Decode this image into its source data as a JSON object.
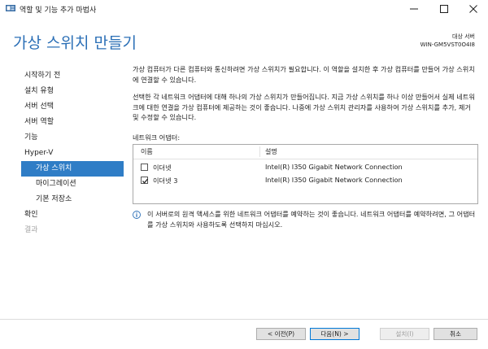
{
  "window": {
    "title": "역할 및 기능 추가 마법사"
  },
  "header": {
    "page_title": "가상 스위치 만들기",
    "target_label": "대상 서버",
    "target_value": "WIN-GM5VST0O4I8"
  },
  "nav": {
    "items": [
      {
        "label": "시작하기 전"
      },
      {
        "label": "설치 유형"
      },
      {
        "label": "서버 선택"
      },
      {
        "label": "서버 역할"
      },
      {
        "label": "기능"
      },
      {
        "label": "Hyper-V"
      },
      {
        "label": "가상 스위치"
      },
      {
        "label": "마이그레이션"
      },
      {
        "label": "기본 저장소"
      },
      {
        "label": "확인"
      },
      {
        "label": "결과"
      }
    ]
  },
  "content": {
    "paragraph1": "가상 컴퓨터가 다른 컴퓨터와 통신하려면 가상 스위치가 필요합니다. 이 역할을 설치한 후 가상 컴퓨터를 만들어 가상 스위치에 연결할 수 있습니다.",
    "paragraph2": "선택한 각 네트워크 어댑터에 대해 하나의 가상 스위치가 만들어집니다. 지금 가상 스위치를 하나 이상 만들어서 실제 네트워크에 대한 연결을 가상 컴퓨터에 제공하는 것이 좋습니다. 나중에 가상 스위치 관리자를 사용하여 가상 스위치를 추가, 제거 및 수정할 수 있습니다.",
    "adapter_label": "네트워크 어댑터:",
    "table": {
      "headers": {
        "name": "이름",
        "description": "설명"
      },
      "rows": [
        {
          "name": "이더넷",
          "description": "Intel(R) I350 Gigabit Network Connection",
          "checked": false
        },
        {
          "name": "이더넷 3",
          "description": "Intel(R) I350 Gigabit Network Connection",
          "checked": true
        }
      ]
    },
    "info_text": "이 서버로의 원격 액세스를 위한 네트워크 어댑터를 예약하는 것이 좋습니다. 네트워크 어댑터를 예약하려면, 그 어댑터를 가상 스위치와 사용하도록 선택하지 마십시오."
  },
  "footer": {
    "prev_label": "< 이전(P)",
    "next_label": "다음(N) >",
    "install_label": "설치(I)",
    "cancel_label": "취소"
  },
  "icons": {
    "app": "server-manager-icon",
    "minimize": "minimize-icon",
    "maximize": "maximize-icon",
    "close": "close-icon",
    "info": "info-icon",
    "check": "checkmark-icon"
  },
  "colors": {
    "title_blue": "#2b6fb6",
    "nav_active": "#2f7dc6",
    "primary_border": "#0078d7"
  }
}
